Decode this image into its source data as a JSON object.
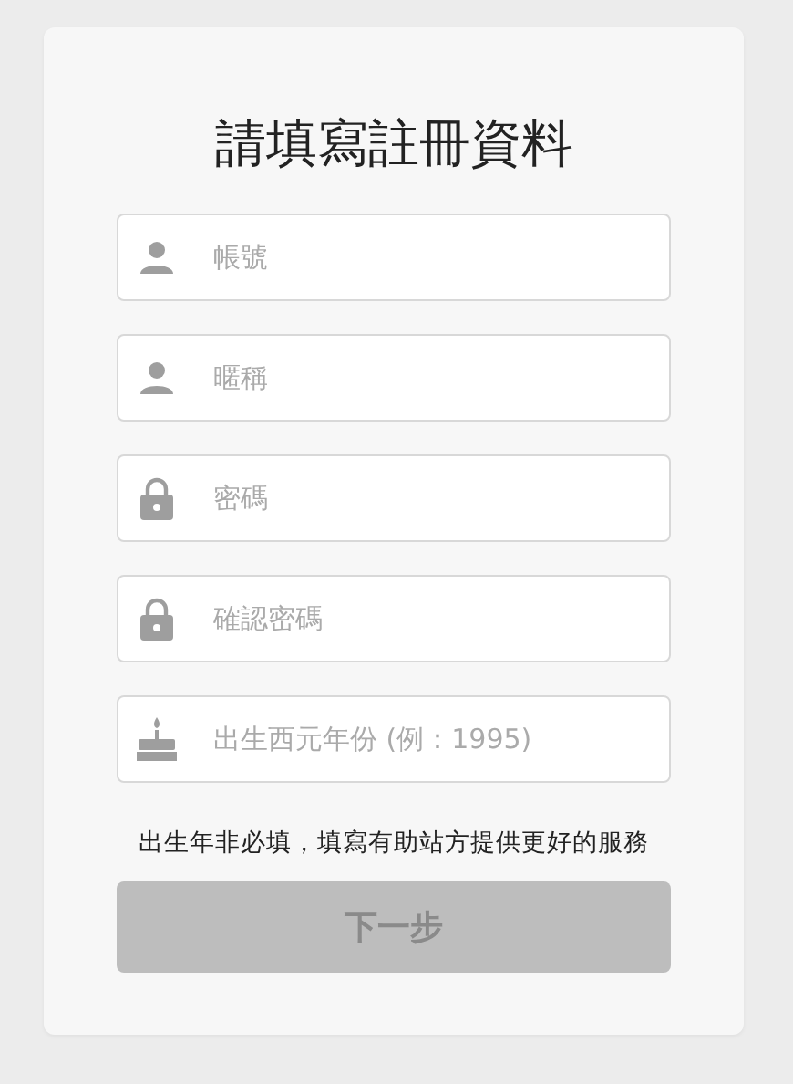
{
  "title": "請填寫註冊資料",
  "fields": [
    {
      "kind": "person",
      "placeholder": "帳號"
    },
    {
      "kind": "person",
      "placeholder": "暱稱"
    },
    {
      "kind": "lock",
      "placeholder": "密碼"
    },
    {
      "kind": "lock",
      "placeholder": "確認密碼"
    },
    {
      "kind": "cake",
      "placeholder": "出生西元年份 (例：1995)"
    }
  ],
  "note": "出生年非必填，填寫有助站方提供更好的服務",
  "button": {
    "label": "下一步",
    "disabled": true
  }
}
